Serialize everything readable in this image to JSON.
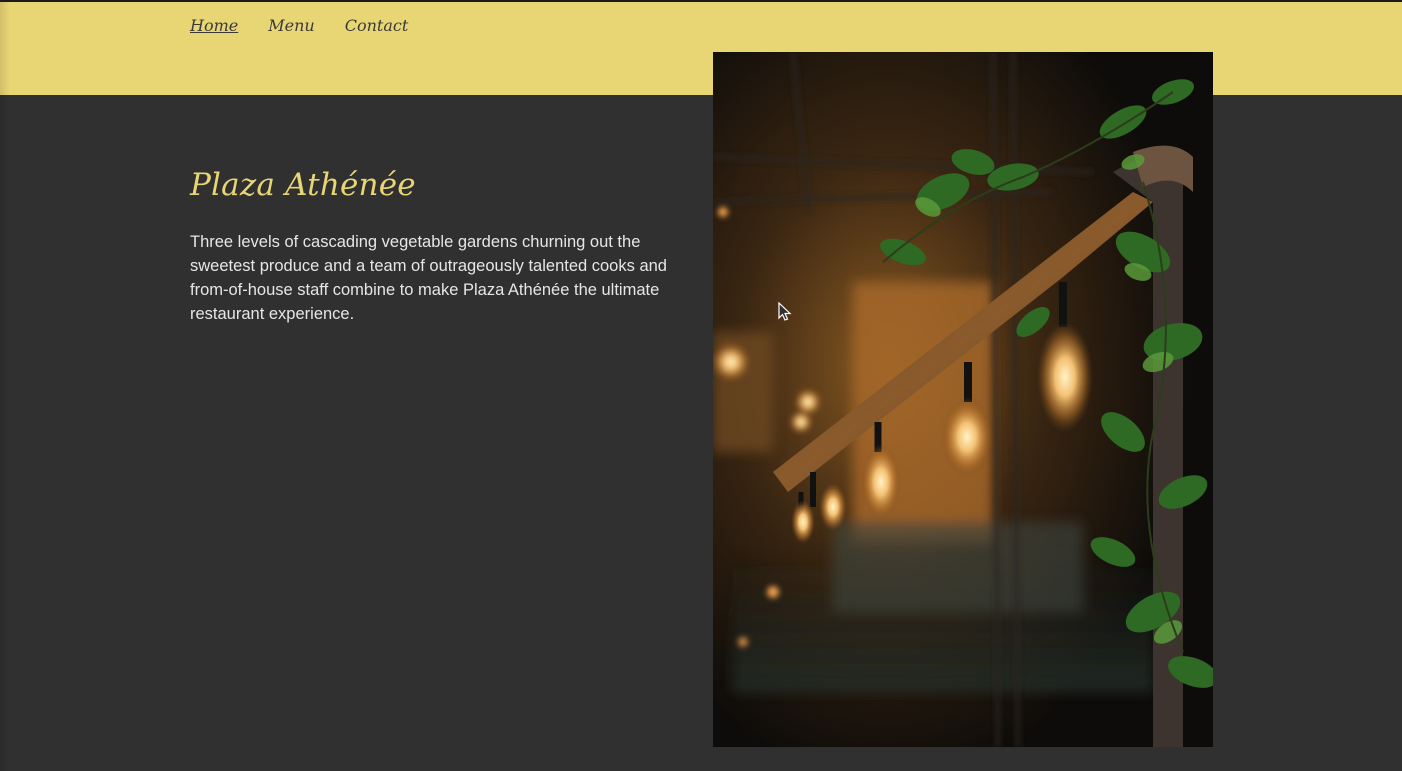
{
  "nav": {
    "items": [
      {
        "label": "Home",
        "active": true
      },
      {
        "label": "Menu",
        "active": false
      },
      {
        "label": "Contact",
        "active": false
      }
    ]
  },
  "hero": {
    "title": "Plaza Athénée",
    "description": "Three levels of cascading vegetable gardens churning out the sweetest produce and a team of outrageously talented cooks and from-of-house staff combine to make Plaza Athénée the ultimate restaurant experience."
  },
  "image": {
    "subject": "restaurant-interior-edison-bulbs-with-ivy"
  },
  "colors": {
    "header": "#e8d574",
    "background": "#303030",
    "accent": "#e8d574",
    "nav_text": "#3a3a3a",
    "body_text": "#e6e6e6"
  }
}
